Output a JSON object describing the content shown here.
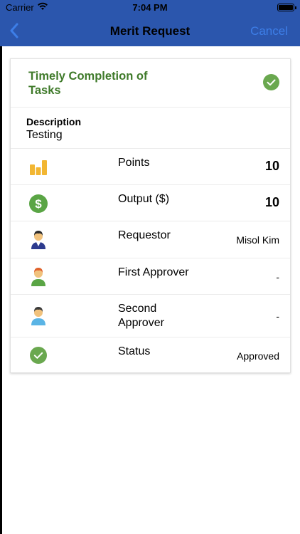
{
  "status_bar": {
    "carrier": "Carrier",
    "time": "7:04 PM"
  },
  "nav": {
    "title": "Merit Request",
    "cancel_label": "Cancel",
    "back_icon": "chevron-left-icon"
  },
  "card": {
    "title": "Timely Completion of Tasks",
    "title_icon": "check-circle-icon",
    "description_label": "Description",
    "description_value": "Testing",
    "rows": [
      {
        "icon": "bar-chart-icon",
        "label": "Points",
        "value": "10"
      },
      {
        "icon": "dollar-circle-icon",
        "label": "Output ($)",
        "value": "10"
      },
      {
        "icon": "person-icon",
        "label": "Requestor",
        "value": "Misol Kim"
      },
      {
        "icon": "person-icon",
        "label": "First Approver",
        "value": "-"
      },
      {
        "icon": "person-icon",
        "label": "Second Approver",
        "value": "-"
      },
      {
        "icon": "check-circle-icon",
        "label": "Status",
        "value": "Approved"
      }
    ]
  },
  "colors": {
    "nav_bg": "#2b56ad",
    "accent_green": "#3f7a2a",
    "check_green": "#6aa84f",
    "cancel_blue": "#3d7ee8"
  }
}
